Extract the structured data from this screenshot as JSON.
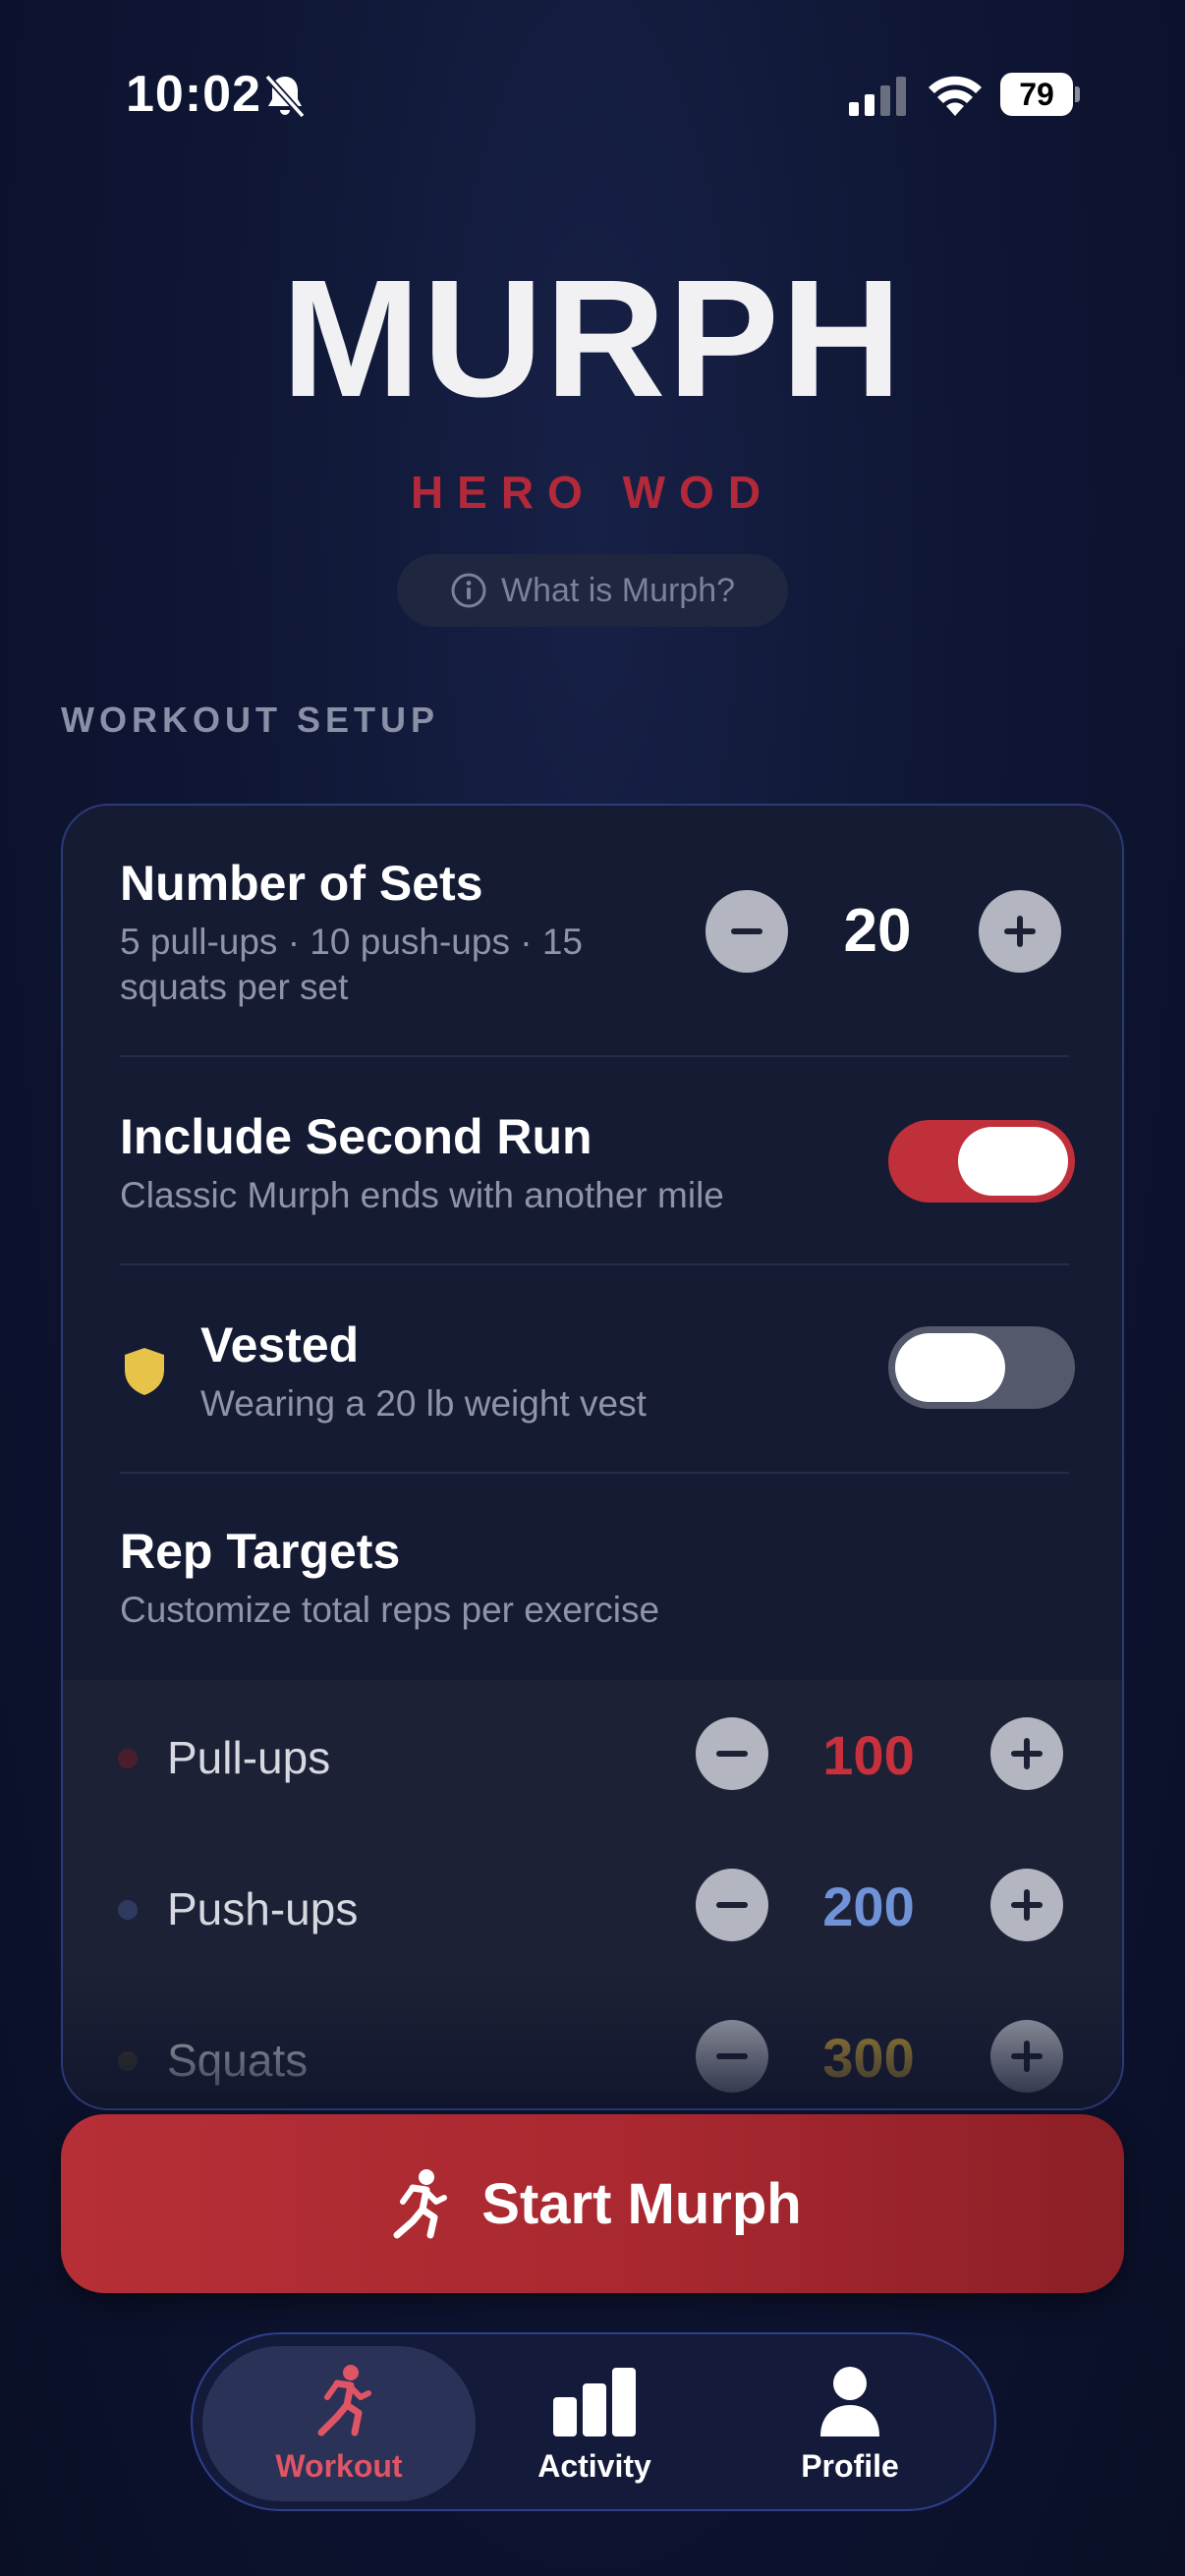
{
  "status_bar": {
    "time": "10:02",
    "battery": "79"
  },
  "header": {
    "title": "MURPH",
    "subtitle": "HERO WOD",
    "info_button": "What is Murph?"
  },
  "section_label": "WORKOUT SETUP",
  "sets": {
    "title": "Number of Sets",
    "subtitle": "5 pull-ups · 10 push-ups · 15 squats per set",
    "value": "20"
  },
  "second_run": {
    "title": "Include Second Run",
    "subtitle": "Classic Murph ends with another mile",
    "enabled": true
  },
  "vested": {
    "title": "Vested",
    "subtitle": "Wearing a 20 lb weight vest",
    "enabled": false
  },
  "rep_targets": {
    "title": "Rep Targets",
    "subtitle": "Customize total reps per exercise",
    "items": [
      {
        "label": "Pull-ups",
        "value": "100",
        "color": "#c8303c",
        "dot": "#4a1f2b"
      },
      {
        "label": "Push-ups",
        "value": "200",
        "color": "#6f93d6",
        "dot": "#2e3b5f"
      },
      {
        "label": "Squats",
        "value": "300",
        "color": "#c9a43a",
        "dot": "#3f3c2f"
      }
    ]
  },
  "start_button": "Start Murph",
  "tabs": [
    {
      "label": "Workout",
      "icon": "run-icon",
      "active": true
    },
    {
      "label": "Activity",
      "icon": "chart-bars-icon",
      "active": false
    },
    {
      "label": "Profile",
      "icon": "person-icon",
      "active": false
    }
  ],
  "colors": {
    "accent_red": "#b62f37",
    "toggle_on": "#c0303a",
    "toggle_off": "#545a6b",
    "vest_yellow": "#e8c34a"
  }
}
